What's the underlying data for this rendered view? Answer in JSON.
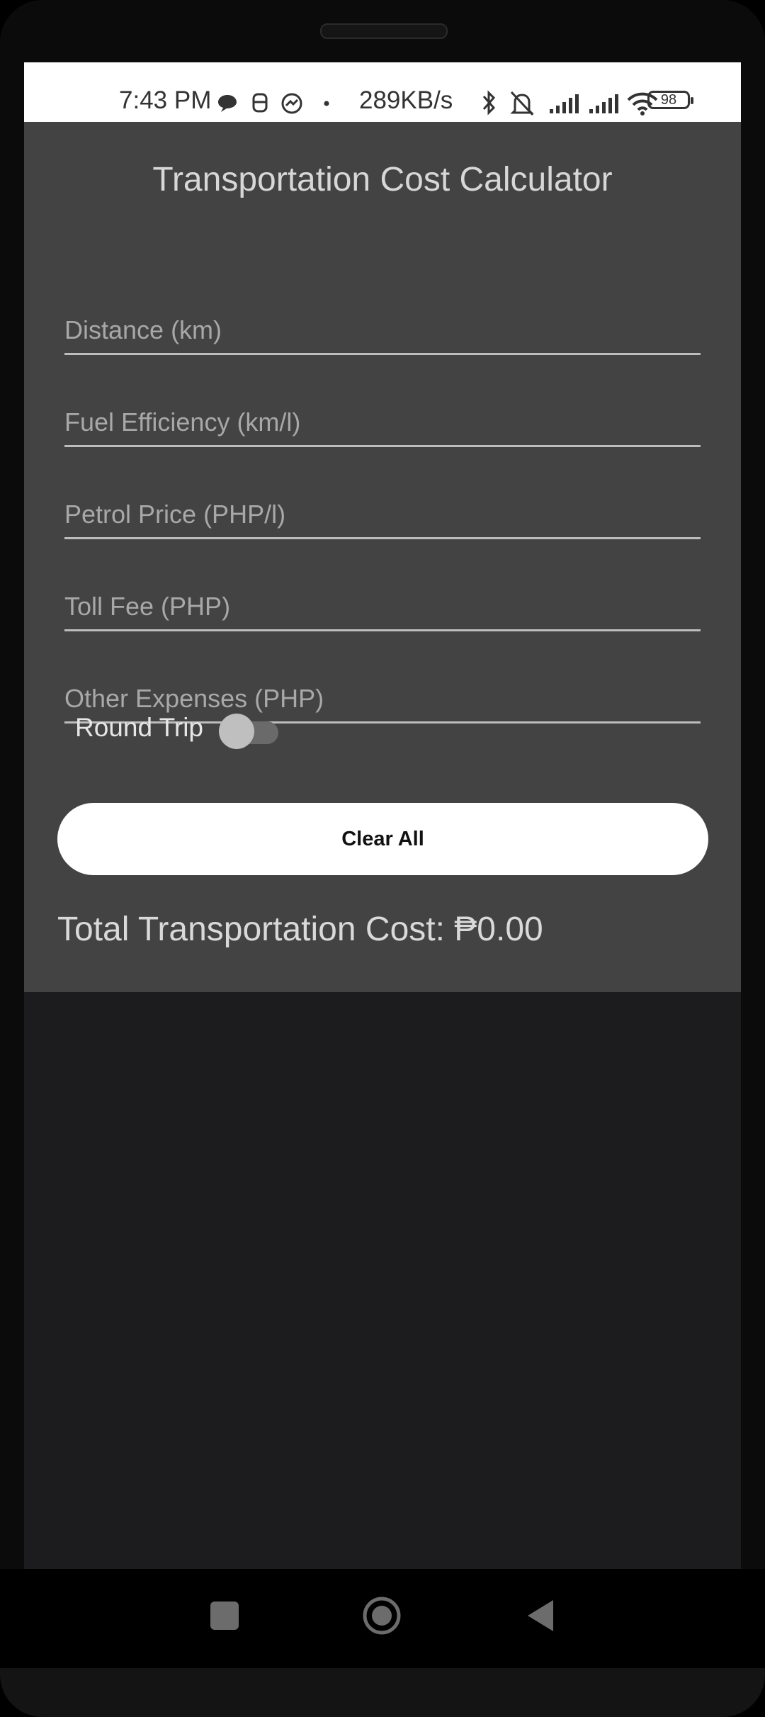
{
  "status_bar": {
    "time": "7:43 PM",
    "network_speed": "289KB/s",
    "battery": "98",
    "icons": [
      "chat-bubble-icon",
      "app-icon",
      "messenger-icon",
      "dot-icon",
      "bluetooth-icon",
      "bell-muted-icon",
      "signal-icon",
      "signal-icon",
      "wifi-icon",
      "battery-icon"
    ]
  },
  "app": {
    "title": "Transportation Cost Calculator",
    "fields": {
      "distance": {
        "placeholder": "Distance (km)",
        "value": ""
      },
      "fuel_efficiency": {
        "placeholder": "Fuel Efficiency (km/l)",
        "value": ""
      },
      "petrol_price": {
        "placeholder": "Petrol Price (PHP/l)",
        "value": ""
      },
      "toll_fee": {
        "placeholder": "Toll Fee (PHP)",
        "value": ""
      },
      "other_expenses": {
        "placeholder": "Other Expenses (PHP)",
        "value": ""
      }
    },
    "round_trip": {
      "label": "Round Trip",
      "on": false
    },
    "clear_label": "Clear All",
    "total_text": "Total Transportation Cost: ₱0.00"
  },
  "colors": {
    "card": "#434343",
    "background": "#1c1c1e",
    "button": "#ffffff",
    "underline": "#bdbdbd"
  },
  "nav": {
    "icons": [
      "recents-square-icon",
      "home-circle-icon",
      "back-triangle-icon"
    ]
  }
}
